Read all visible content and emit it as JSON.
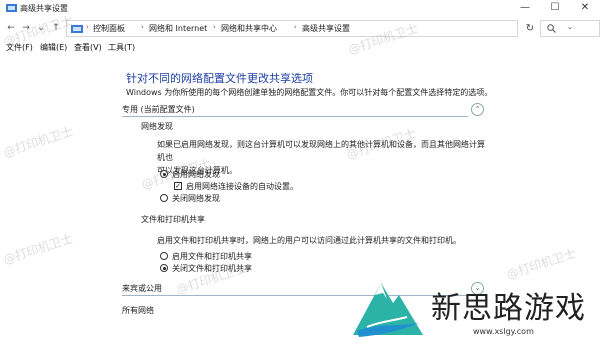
{
  "window": {
    "title": "高级共享设置",
    "minimize": "—",
    "maximize": "☐",
    "close": "✕"
  },
  "nav": {
    "back": "←",
    "forward": "→",
    "recent": "⌄",
    "up": "↑",
    "refresh": "↻",
    "breadcrumbs": [
      "控制面板",
      "网络和 Internet",
      "网络和共享中心",
      "高级共享设置"
    ],
    "separator": "›",
    "dropdown": "⌄"
  },
  "menu": {
    "items": [
      "文件(F)",
      "编辑(E)",
      "查看(V)",
      "工具(T)"
    ]
  },
  "main": {
    "heading": "针对不同的网络配置文件更改共享选项",
    "description": "Windows 为你所使用的每个网络创建单独的网络配置文件。你可以针对每个配置文件选择特定的选项。",
    "profile_private": {
      "label": "专用 (当前配置文件)",
      "toggle": "⌃",
      "discovery": {
        "title": "网络发现",
        "text_line1": "如果已启用网络发现，则这台计算机可以发现网络上的其他计算机和设备，而且其他网络计算机也",
        "text_line2": "可以发现这台计算机。",
        "option_on": "启用网络发现",
        "option_auto": "启用网络连接设备的自动设置。",
        "option_off": "关闭网络发现",
        "selected": "on",
        "auto_checked": true
      },
      "file_print": {
        "title": "文件和打印机共享",
        "text": "启用文件和打印机共享时，网络上的用户可以访问通过此计算机共享的文件和打印机。",
        "option_on": "启用文件和打印机共享",
        "option_off": "关闭文件和打印机共享",
        "selected": "off"
      }
    },
    "profile_guest": {
      "label": "来宾或公用",
      "toggle": "⌄"
    },
    "profile_all": {
      "label": "所有网络"
    }
  },
  "watermarks": [
    "@打印机卫士",
    "@打印机卫士",
    "@打印机卫士",
    "@打印机卫士",
    "@打印机卫士",
    "@打印机卫士",
    "@打印机卫士",
    "@打印机卫士"
  ],
  "brand": {
    "name": "新思路游戏",
    "url": "www.xslgy.com"
  },
  "colors": {
    "heading": "#1d3ea3",
    "section_line": "#9fb6c9"
  }
}
